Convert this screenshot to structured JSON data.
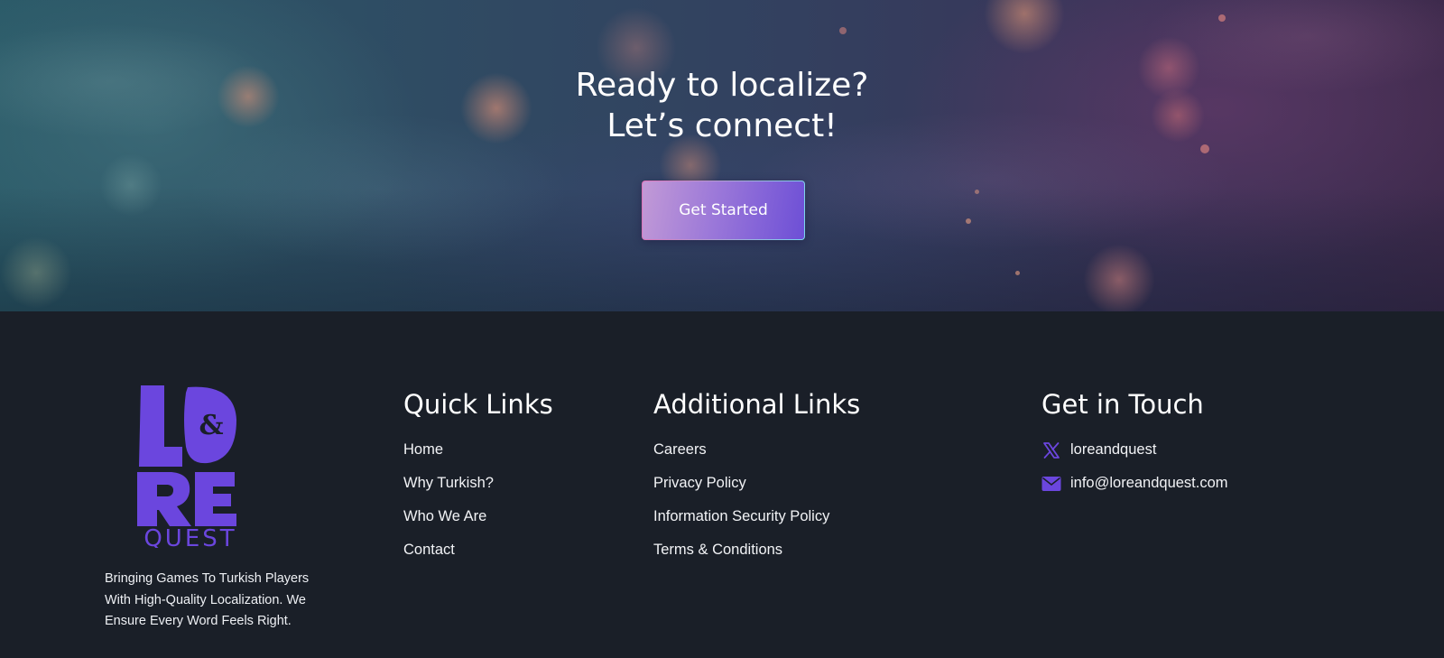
{
  "hero": {
    "title_line1": "Ready to localize?",
    "title_line2": "Let’s connect!",
    "cta_label": "Get Started"
  },
  "brand": {
    "logo_alt": "Lore & Quest",
    "logo_letters_top": "LO",
    "logo_amp": "&",
    "logo_letters_mid": "RE",
    "logo_word": "QUEST",
    "tagline": "Bringing Games To Turkish Players With High-Quality Localization. We Ensure Every Word Feels Right.",
    "accent_color": "#6b46de"
  },
  "quick_links": {
    "heading": "Quick Links",
    "items": [
      {
        "label": "Home"
      },
      {
        "label": "Why Turkish?"
      },
      {
        "label": "Who We Are"
      },
      {
        "label": "Contact"
      }
    ]
  },
  "additional_links": {
    "heading": "Additional Links",
    "items": [
      {
        "label": "Careers"
      },
      {
        "label": "Privacy Policy"
      },
      {
        "label": "Information Security Policy"
      },
      {
        "label": "Terms & Conditions"
      }
    ]
  },
  "contact": {
    "heading": "Get in Touch",
    "items": [
      {
        "icon": "x-twitter-icon",
        "label": "loreandquest"
      },
      {
        "icon": "envelope-icon",
        "label": "info@loreandquest.com"
      }
    ]
  }
}
